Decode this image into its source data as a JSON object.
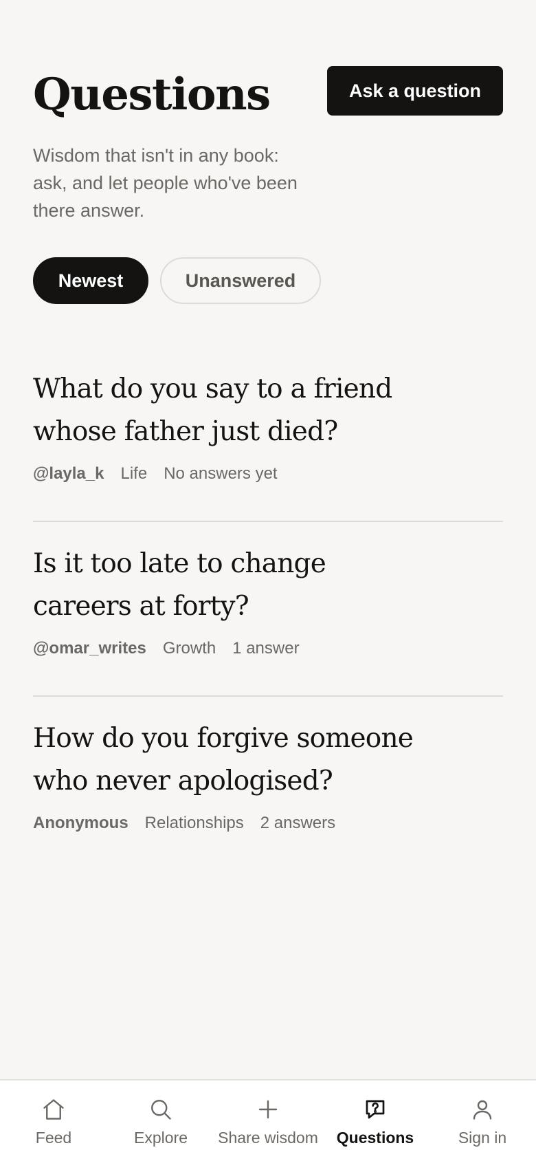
{
  "header": {
    "title": "Questions",
    "subtitle": "Wisdom that isn't in any book: ask, and let people who've been there answer.",
    "ask_button": "Ask a question"
  },
  "filters": [
    {
      "label": "Newest",
      "active": true
    },
    {
      "label": "Unanswered",
      "active": false
    }
  ],
  "questions": [
    {
      "title": "What do you say to a friend whose father just died?",
      "author": "@layla_k",
      "category": "Life",
      "answers": "No answers yet"
    },
    {
      "title": "Is it too late to change careers at forty?",
      "author": "@omar_writes",
      "category": "Growth",
      "answers": "1 answer"
    },
    {
      "title": "How do you forgive someone who never apologised?",
      "author": "Anonymous",
      "category": "Relationships",
      "answers": "2 answers"
    }
  ],
  "bottom_nav": [
    {
      "label": "Feed",
      "icon": "home-icon",
      "active": false
    },
    {
      "label": "Explore",
      "icon": "search-icon",
      "active": false
    },
    {
      "label": "Share wisdom",
      "icon": "plus-icon",
      "active": false
    },
    {
      "label": "Questions",
      "icon": "question-bubble-icon",
      "active": true
    },
    {
      "label": "Sign in",
      "icon": "user-icon",
      "active": false
    }
  ],
  "colors": {
    "background": "#f7f6f4",
    "primary": "#141312",
    "muted_text": "#6b6864",
    "divider": "#dedbd6"
  }
}
